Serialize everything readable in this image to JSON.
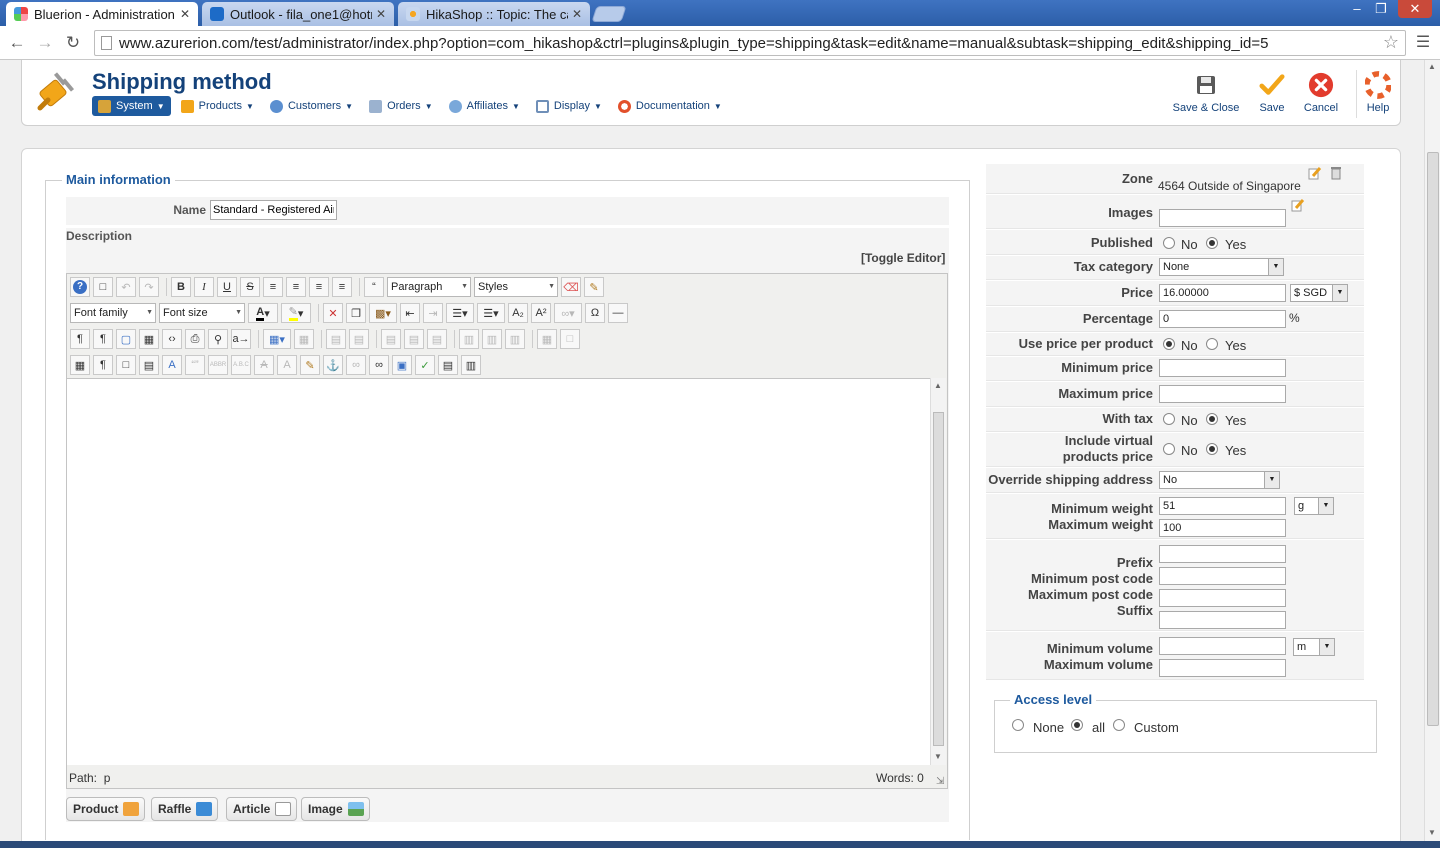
{
  "browser": {
    "tabs": [
      {
        "label": "Bluerion - Administration",
        "active": true
      },
      {
        "label": "Outlook - fila_one1@hotm",
        "active": false
      },
      {
        "label": "HikaShop :: Topic: The ca",
        "active": false
      }
    ],
    "close_glyph": "✕",
    "url": "www.azurerion.com/test/administrator/index.php?option=com_hikashop&ctrl=plugins&plugin_type=shipping&task=edit&name=manual&subtask=shipping_edit&shipping_id=5"
  },
  "header": {
    "title": "Shipping method",
    "menu": [
      {
        "label": "System",
        "selected": true,
        "color": "#d6a33a"
      },
      {
        "label": "Products",
        "selected": false,
        "color": "#f2a619"
      },
      {
        "label": "Customers",
        "selected": false,
        "color": "#5b8fd0"
      },
      {
        "label": "Orders",
        "selected": false,
        "color": "#9bb2cf"
      },
      {
        "label": "Affiliates",
        "selected": false,
        "color": "#7aa8da"
      },
      {
        "label": "Display",
        "selected": false,
        "color": "#6f8fb8"
      },
      {
        "label": "Documentation",
        "selected": false,
        "color": "#e2502b"
      }
    ],
    "toolbar": {
      "save_close": "Save & Close",
      "save": "Save",
      "cancel": "Cancel",
      "help": "Help"
    }
  },
  "main": {
    "legend": "Main information",
    "name_label": "Name",
    "name_value": "Standard - Registered Air",
    "description_label": "Description",
    "toggle_editor": "[Toggle Editor]",
    "editor": {
      "format_select": "Paragraph",
      "styles_select": "Styles",
      "font_family": "Font family",
      "font_size": "Font size",
      "path_label": "Path:",
      "path_value": "p",
      "words_label": "Words:",
      "words_value": "0"
    },
    "plugin_buttons": [
      "Product",
      "Raffle",
      "Article",
      "Image"
    ]
  },
  "form": {
    "zone_label": "Zone",
    "zone_value": "4564 Outside of Singapore",
    "images_label": "Images",
    "published_label": "Published",
    "tax_category_label": "Tax category",
    "tax_category_value": "None",
    "price_label": "Price",
    "price_value": "16.00000",
    "currency_value": "$ SGD",
    "percentage_label": "Percentage",
    "percentage_value": "0",
    "percent_sign": "%",
    "use_price_per_product_label": "Use price per product",
    "minimum_price_label": "Minimum price",
    "maximum_price_label": "Maximum price",
    "with_tax_label": "With tax",
    "include_virtual_label_1": "Include virtual",
    "include_virtual_label_2": "products price",
    "override_shipping_label": "Override shipping address",
    "override_shipping_value": "No",
    "minimum_weight_label": "Minimum weight",
    "maximum_weight_label": "Maximum weight",
    "minimum_weight_value": "51",
    "maximum_weight_value": "100",
    "weight_unit": "g",
    "prefix_label": "Prefix",
    "minimum_post_code_label": "Minimum post code",
    "maximum_post_code_label": "Maximum post code",
    "suffix_label": "Suffix",
    "minimum_volume_label": "Minimum volume",
    "maximum_volume_label": "Maximum volume",
    "volume_unit": "m",
    "no": "No",
    "yes": "Yes",
    "access_legend": "Access level",
    "access_none": "None",
    "access_all": "all",
    "access_custom": "Custom"
  }
}
